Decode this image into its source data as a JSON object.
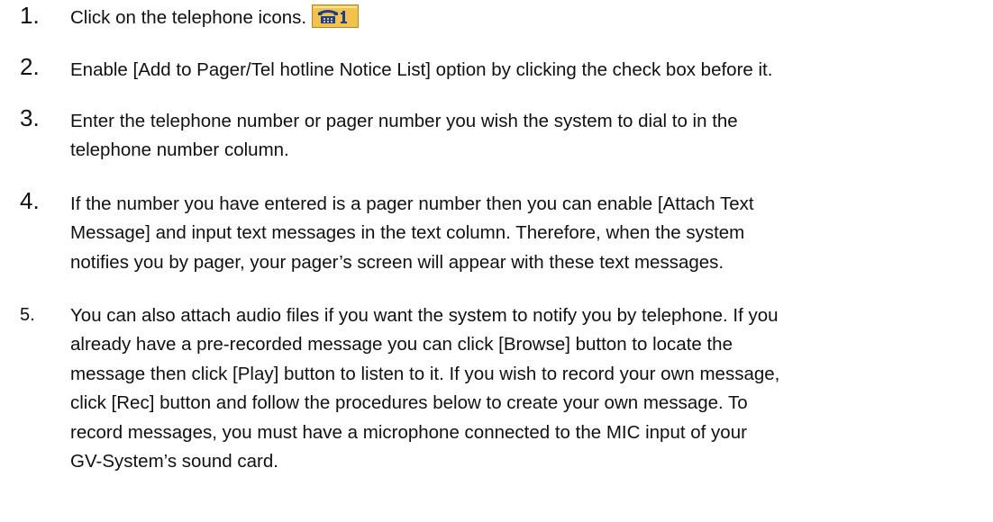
{
  "steps": [
    {
      "number": "1.",
      "text": "Click on the telephone icons.",
      "icon": "telephone-icon"
    },
    {
      "number": "2.",
      "text": "Enable [Add to Pager/Tel hotline Notice List] option by clicking the check box before it."
    },
    {
      "number": "3.",
      "line1": "Enter the telephone number or pager number you wish the system to dial to in the",
      "line2": "telephone number column."
    },
    {
      "number": "4.",
      "line1": "If the number you have entered is a pager number then you can enable [Attach Text",
      "line2": "Message] and input text messages in the text column. Therefore, when the system",
      "line3": "notifies you by pager, your pager’s screen will appear with these text messages."
    },
    {
      "number": "5.",
      "line1": "You can also attach audio files if you want the system to notify you by telephone. If you",
      "line2": "already have a pre-recorded message you can click [Browse] button to locate the",
      "line3": "message then click [Play] button to listen to it. If you wish to record your own message,",
      "line4": "click [Rec] button and follow the procedures below to create your own message. To",
      "line5": "record messages, you must have a microphone connected to the MIC input of your",
      "line6": "GV-System’s sound card."
    }
  ],
  "colors": {
    "icon_fill": "#f2c24a",
    "icon_border": "#b8861e",
    "icon_glyph": "#1a3f9a"
  }
}
